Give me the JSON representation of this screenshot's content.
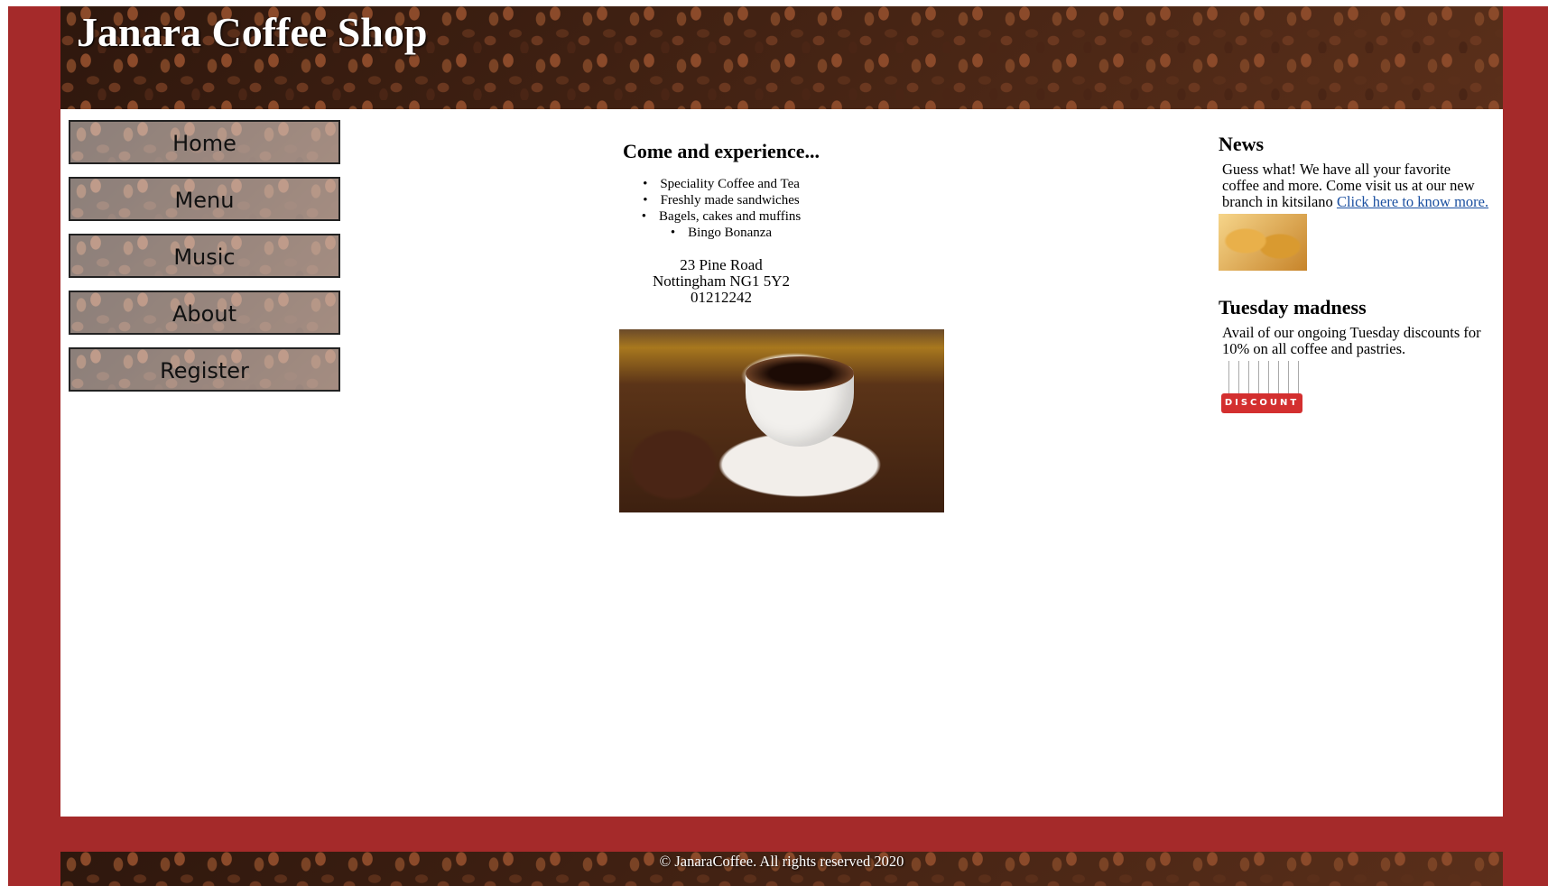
{
  "header": {
    "site_title": "Janara Coffee Shop"
  },
  "nav": {
    "items": [
      {
        "label": "Home"
      },
      {
        "label": "Menu"
      },
      {
        "label": "Music"
      },
      {
        "label": "About"
      },
      {
        "label": "Register"
      }
    ]
  },
  "main": {
    "heading": "Come and experience...",
    "features": [
      "Speciality Coffee and Tea",
      "Freshly made sandwiches",
      "Bagels, cakes and muffins",
      "Bingo Bonanza"
    ],
    "address": {
      "street": "23 Pine Road",
      "city": "Nottingham NG1 5Y2",
      "phone": "01212242"
    }
  },
  "sidebar": {
    "news_heading": "News",
    "news_text": "Guess what! We have all your favorite coffee and more. Come visit us at our new branch in kitsilano",
    "news_link": "Click here to know more.",
    "promo_heading": "Tuesday madness",
    "promo_text": "Avail of our ongoing Tuesday discounts for 10% on all coffee and pastries.",
    "discount_label": "DISCOUNT"
  },
  "footer": {
    "copyright": "© JanaraCoffee. All rights reserved 2020"
  },
  "colors": {
    "frame": "#a52a2a",
    "link": "#1a4fa0"
  }
}
